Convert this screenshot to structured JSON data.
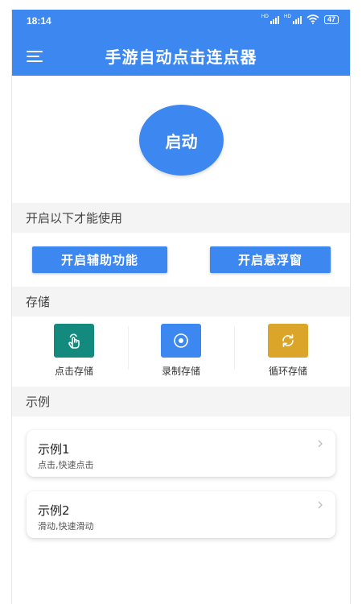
{
  "status_bar": {
    "time": "18:14",
    "signal1_tag": "HD",
    "signal2_tag": "HD",
    "battery": "47"
  },
  "app_bar": {
    "title": "手游自动点击连点器"
  },
  "start_button": {
    "label": "启动"
  },
  "sections": {
    "prerequisite": {
      "title": "开启以下才能使用"
    },
    "storage": {
      "title": "存储"
    },
    "examples": {
      "title": "示例"
    }
  },
  "buttons": {
    "accessibility": "开启辅助功能",
    "floating_window": "开启悬浮窗"
  },
  "storage_items": [
    {
      "label": "点击存储",
      "icon": "tap-hand-icon",
      "color": "#138a7d"
    },
    {
      "label": "录制存储",
      "icon": "record-icon",
      "color": "#3d87f0"
    },
    {
      "label": "循环存储",
      "icon": "loop-icon",
      "color": "#dba52a"
    }
  ],
  "examples": [
    {
      "title": "示例1",
      "subtitle": "点击,快速点击"
    },
    {
      "title": "示例2",
      "subtitle": "滑动,快速滑动"
    }
  ],
  "colors": {
    "primary": "#3d87f0",
    "section_bg": "#f4f4f4"
  }
}
